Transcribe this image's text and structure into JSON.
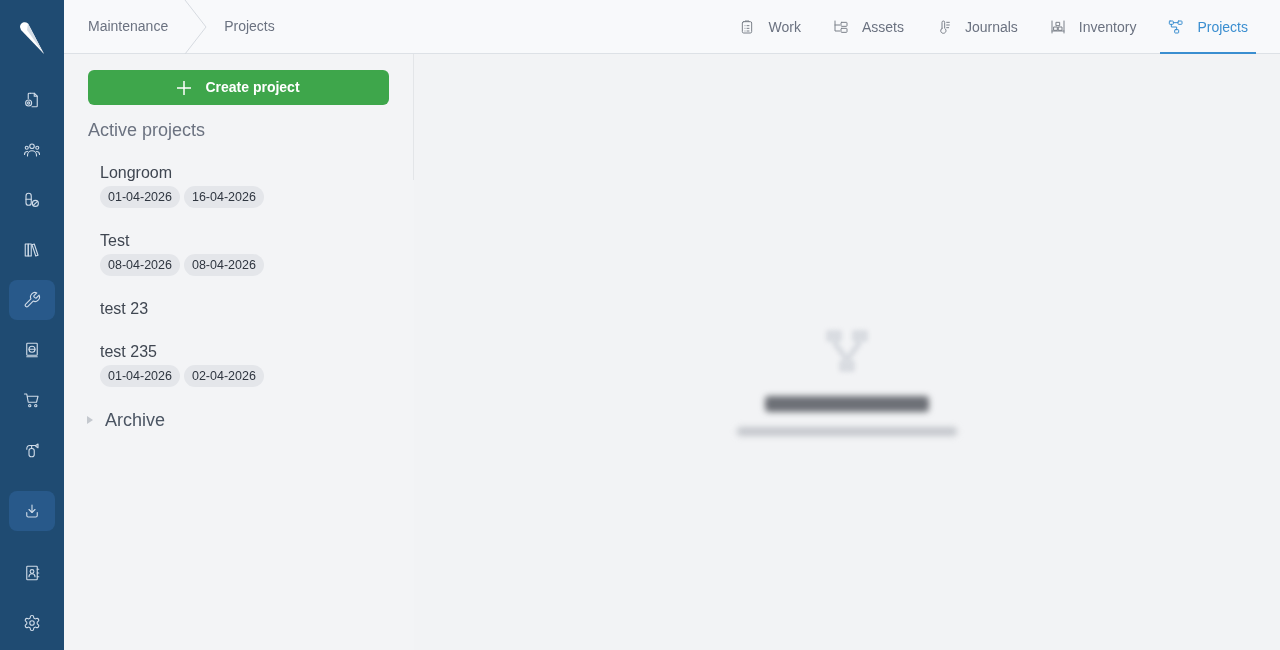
{
  "sidebar": {
    "items": [
      {
        "selected": false
      },
      {
        "selected": false
      },
      {
        "selected": false
      },
      {
        "selected": false
      },
      {
        "selected": true
      },
      {
        "selected": false
      },
      {
        "selected": false
      },
      {
        "selected": false
      },
      {
        "selected": true
      },
      {
        "selected": false
      },
      {
        "selected": false
      }
    ]
  },
  "breadcrumb": [
    "Maintenance",
    "Projects"
  ],
  "tabs": [
    {
      "label": "Work",
      "selected": false
    },
    {
      "label": "Assets",
      "selected": false
    },
    {
      "label": "Journals",
      "selected": false
    },
    {
      "label": "Inventory",
      "selected": false
    },
    {
      "label": "Projects",
      "selected": true
    }
  ],
  "create_button": {
    "label": "Create project"
  },
  "active_projects": {
    "heading": "Active projects",
    "projects": [
      {
        "name": "Longroom",
        "dates": [
          "01-04-2026",
          "16-04-2026"
        ]
      },
      {
        "name": "Test",
        "dates": [
          "08-04-2026",
          "08-04-2026"
        ]
      },
      {
        "name": "test 23"
      },
      {
        "name": "test 235",
        "dates": [
          "01-04-2026",
          "02-04-2026"
        ]
      }
    ]
  },
  "archive": {
    "label": "Archive",
    "expanded": false
  }
}
